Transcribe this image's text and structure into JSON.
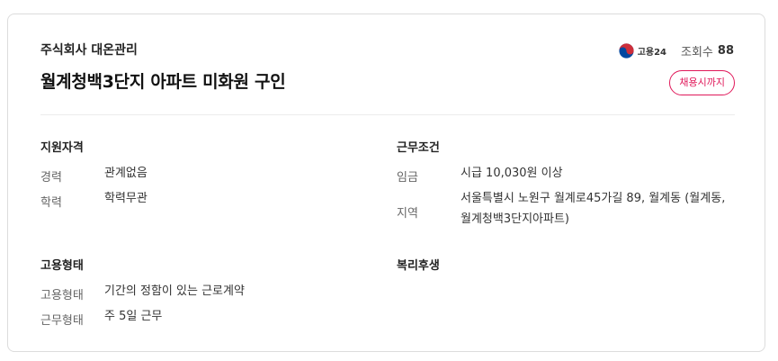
{
  "header": {
    "company": "주식회사 대온관리",
    "title": "월계청백3단지 아파트 미화원 구인",
    "source_logo_text": "고용24",
    "views_label": "조회수",
    "views_count": "88",
    "deadline_badge": "채용시까지"
  },
  "qualifications": {
    "title": "지원자격",
    "rows": [
      {
        "label": "경력",
        "value": "관계없음"
      },
      {
        "label": "학력",
        "value": "학력무관"
      }
    ]
  },
  "work_conditions": {
    "title": "근무조건",
    "wage_label": "임금",
    "wage_value": "시급 10,030원 이상",
    "region_label": "지역",
    "region_line1": "서울특별시 노원구 월계로45가길 89, 월계동 (월계동,",
    "region_line2": "월계청백3단지아파트)"
  },
  "employment": {
    "title": "고용형태",
    "rows": [
      {
        "label": "고용형태",
        "value": "기간의 정함이 있는 근로계약"
      },
      {
        "label": "근무형태",
        "value": "주 5일 근무"
      }
    ]
  },
  "benefits": {
    "title": "복리후생"
  },
  "icons": {
    "source_logo": "taegeuk-logo-icon"
  },
  "colors": {
    "accent": "#e0195a",
    "logo_red": "#cd2e3a",
    "logo_blue": "#0047a0"
  }
}
